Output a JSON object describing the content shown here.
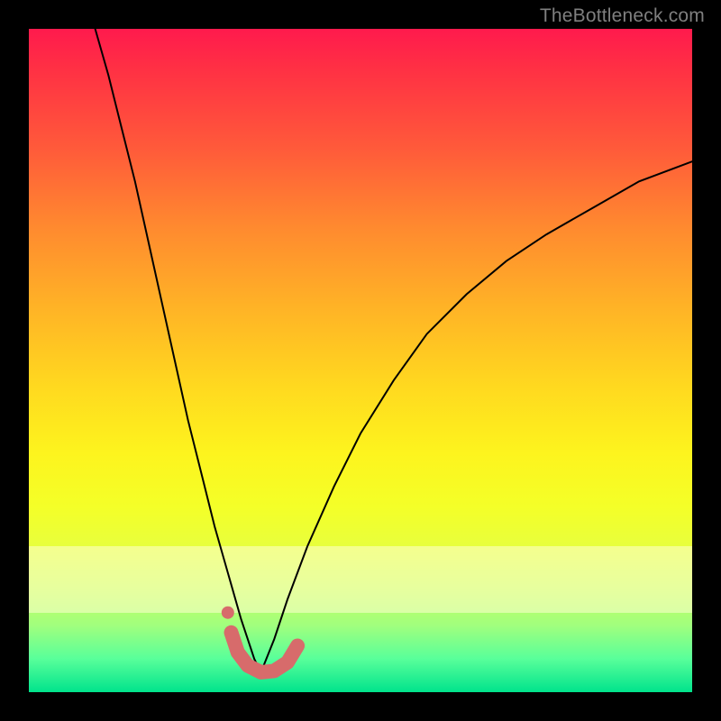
{
  "watermark": "TheBottleneck.com",
  "colors": {
    "frame": "#000000",
    "watermark": "#7f7f7f",
    "curve": "#000000",
    "marker": "#d76b6b",
    "gradient_stops": [
      "#ff1a4d",
      "#ff3044",
      "#ff5a3a",
      "#ff8a2f",
      "#ffb326",
      "#ffd91f",
      "#fdf41e",
      "#f4ff28",
      "#e8ff3c",
      "#ccff5e",
      "#a0ff7e",
      "#58ff9a",
      "#00e38c"
    ]
  },
  "chart_data": {
    "type": "line",
    "title": "",
    "xlabel": "",
    "ylabel": "",
    "xlim": [
      0,
      100
    ],
    "ylim": [
      0,
      100
    ],
    "note": "Relative units (percent of plot area). y=0 at bottom, y=100 at top. Two curves form a V whose trough sits near x≈34, y≈3. A salmon highlight segment traces part of the trough.",
    "series": [
      {
        "name": "left-curve",
        "x": [
          10,
          12,
          14,
          16,
          18,
          20,
          22,
          24,
          26,
          28,
          30,
          32,
          34,
          35
        ],
        "values": [
          100,
          93,
          85,
          77,
          68,
          59,
          50,
          41,
          33,
          25,
          18,
          11,
          5,
          3
        ]
      },
      {
        "name": "right-curve",
        "x": [
          35,
          37,
          39,
          42,
          46,
          50,
          55,
          60,
          66,
          72,
          78,
          85,
          92,
          100
        ],
        "values": [
          3,
          8,
          14,
          22,
          31,
          39,
          47,
          54,
          60,
          65,
          69,
          73,
          77,
          80
        ]
      }
    ],
    "highlight_segment": {
      "name": "trough-marker",
      "x": [
        30.5,
        31.5,
        33,
        35,
        37,
        39,
        40.5
      ],
      "values": [
        9,
        6,
        4,
        3,
        3.2,
        4.5,
        7
      ]
    },
    "highlight_dot": {
      "x": 30,
      "y": 12
    }
  }
}
